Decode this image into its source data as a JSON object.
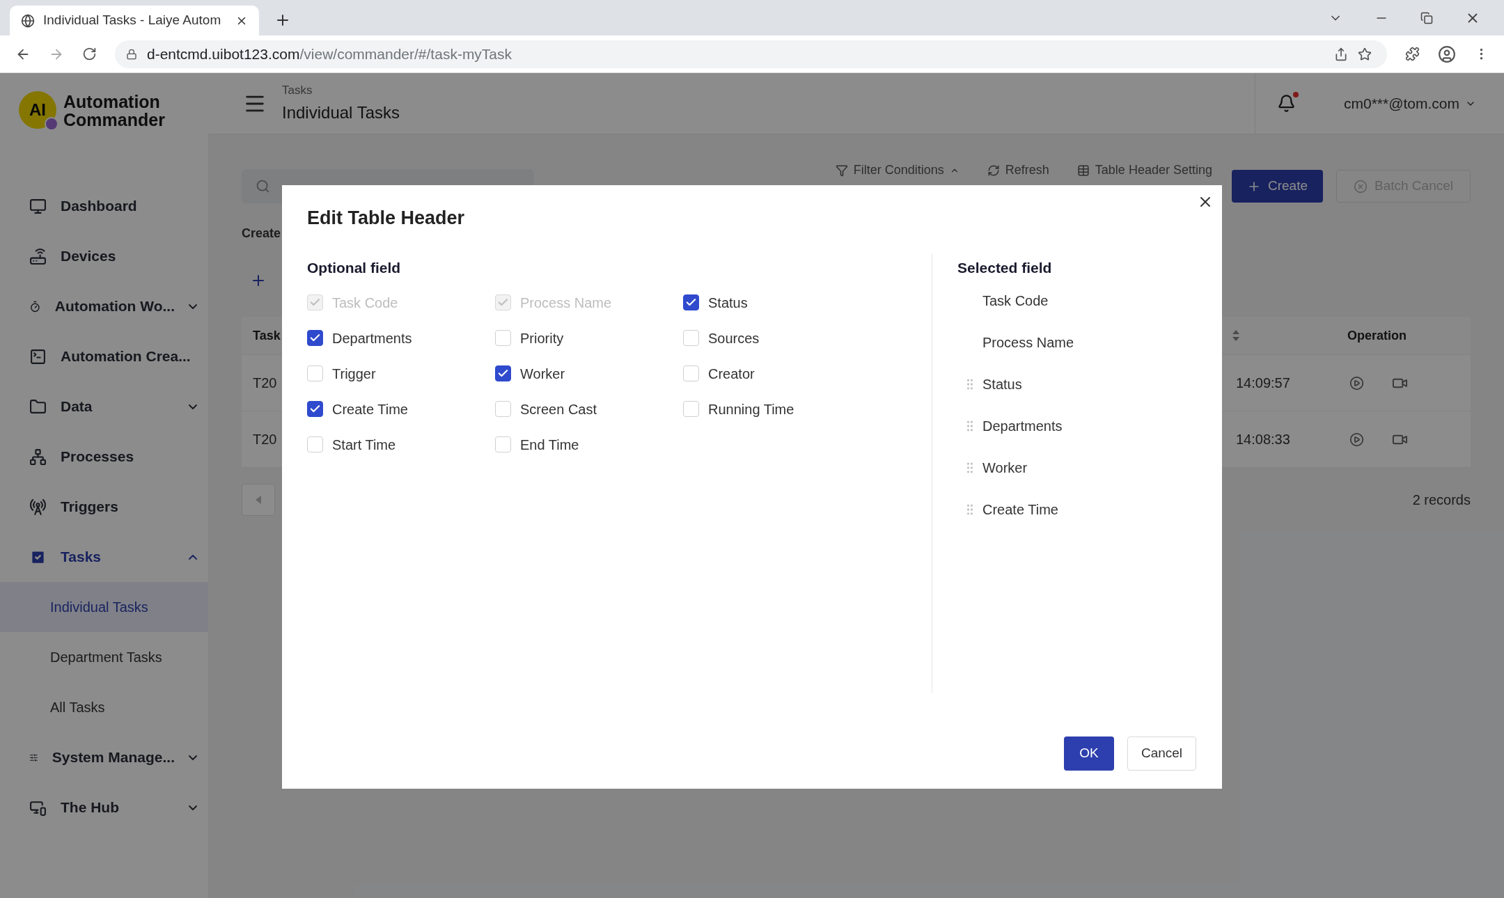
{
  "browser": {
    "tab_title": "Individual Tasks - Laiye Autom",
    "url_host": "d-entcmd.uibot123.com",
    "url_path": "/view/commander/#/task-myTask"
  },
  "sidebar": {
    "logo_mark": "AI",
    "logo_lines": [
      "Automation",
      "Commander"
    ],
    "items": [
      {
        "label": "Dashboard",
        "kind": "link",
        "selected": false
      },
      {
        "label": "Devices",
        "kind": "link",
        "selected": false
      },
      {
        "label": "Automation Wo...",
        "kind": "group",
        "expanded": false,
        "selected": false
      },
      {
        "label": "Automation Crea...",
        "kind": "link",
        "selected": false
      },
      {
        "label": "Data",
        "kind": "group",
        "expanded": false,
        "selected": false
      },
      {
        "label": "Processes",
        "kind": "link",
        "selected": false
      },
      {
        "label": "Triggers",
        "kind": "link",
        "selected": false
      },
      {
        "label": "Tasks",
        "kind": "group",
        "expanded": true,
        "selected": true,
        "children": [
          {
            "label": "Individual Tasks",
            "selected": true
          },
          {
            "label": "Department Tasks",
            "selected": false
          },
          {
            "label": "All Tasks",
            "selected": false
          }
        ]
      },
      {
        "label": "System Manage...",
        "kind": "group",
        "expanded": false,
        "selected": false
      },
      {
        "label": "The Hub",
        "kind": "group",
        "expanded": false,
        "selected": false
      }
    ]
  },
  "header": {
    "breadcrumb": "Tasks",
    "title": "Individual Tasks",
    "unread": true,
    "user": "cm0***@tom.com"
  },
  "toolbar": {
    "filter": "Filter Conditions",
    "refresh": "Refresh",
    "table_setting": "Table Header Setting",
    "create": "Create",
    "batch_cancel": {
      "label": "Batch Cancel",
      "disabled": true
    }
  },
  "section_label": "Create",
  "table": {
    "columns": [
      "Task",
      "",
      "Operation"
    ],
    "rows": [
      {
        "task": "T20",
        "time": "14:09:57"
      },
      {
        "task": "T20",
        "time": "14:08:33"
      }
    ],
    "records": "2 records"
  },
  "dialog": {
    "title": "Edit Table Header",
    "optional_heading": "Optional field",
    "options": [
      {
        "label": "Task Code",
        "checked": true,
        "disabled": true
      },
      {
        "label": "Process Name",
        "checked": true,
        "disabled": true
      },
      {
        "label": "Status",
        "checked": true,
        "disabled": false
      },
      {
        "label": "Departments",
        "checked": true,
        "disabled": false
      },
      {
        "label": "Priority",
        "checked": false,
        "disabled": false
      },
      {
        "label": "Sources",
        "checked": false,
        "disabled": false
      },
      {
        "label": "Trigger",
        "checked": false,
        "disabled": false
      },
      {
        "label": "Worker",
        "checked": true,
        "disabled": false
      },
      {
        "label": "Creator",
        "checked": false,
        "disabled": false
      },
      {
        "label": "Create Time",
        "checked": true,
        "disabled": false
      },
      {
        "label": "Screen Cast",
        "checked": false,
        "disabled": false
      },
      {
        "label": "Running Time",
        "checked": false,
        "disabled": false
      },
      {
        "label": "Start Time",
        "checked": false,
        "disabled": false
      },
      {
        "label": "End Time",
        "checked": false,
        "disabled": false
      }
    ],
    "selected_heading": "Selected field",
    "selected": [
      {
        "label": "Task Code",
        "draggable": false
      },
      {
        "label": "Process Name",
        "draggable": false
      },
      {
        "label": "Status",
        "draggable": true
      },
      {
        "label": "Departments",
        "draggable": true
      },
      {
        "label": "Worker",
        "draggable": true
      },
      {
        "label": "Create Time",
        "draggable": true
      }
    ],
    "ok": "OK",
    "cancel": "Cancel"
  }
}
